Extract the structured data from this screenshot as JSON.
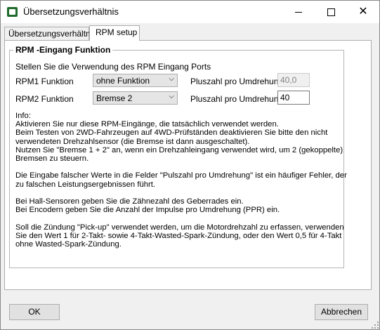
{
  "window": {
    "title": "Übersetzungsverhältnis"
  },
  "tabs": [
    {
      "label": "Übersetzungsverhältnis"
    },
    {
      "label": "RPM setup"
    }
  ],
  "group": {
    "title": "RPM -Eingang Funktion",
    "intro": "Stellen Sie die Verwendung des RPM Eingang Ports",
    "rows": [
      {
        "label": "RPM1 Funktion",
        "select": "ohne Funktion",
        "pulse_label": "Pluszahl pro Umdrehung:",
        "pulse_value": "40,0"
      },
      {
        "label": "RPM2 Funktion",
        "select": "Bremse 2",
        "pulse_label": "Pluszahl pro Umdrehung:",
        "pulse_value": "40"
      }
    ],
    "info": "Info:\nAktivieren Sie nur diese RPM-Eingänge, die tatsächlich verwendet werden.\nBeim Testen von 2WD-Fahrzeugen auf 4WD-Prüfständen deaktivieren Sie bitte den nicht\nverwendeten Drehzahlsensor (die Bremse ist dann ausgeschaltet).\nNutzen Sie \"Bremse 1 + 2\" an, wenn ein Drehzahleingang verwendet wird, um 2 (gekoppelte)\nBremsen zu steuern.\n\nDie Eingabe falscher Werte in die Felder \"Pulszahl pro Umdrehung\" ist ein häufiger Fehler, der\nzu falschen Leistungsergebnissen führt.\n\nBei Hall-Sensoren geben Sie die Zähnezahl des Geberrades ein.\nBei Encodern geben Sie die Anzahl der Impulse pro Umdrehung (PPR) ein.\n\nSoll die Zündung \"Pick-up\" verwendet werden, um die Motordrehzahl zu erfassen, verwenden\nSie den Wert 1 für 2-Takt- sowie 4-Takt-Wasted-Spark-Zündung, oder den Wert 0,5 für 4-Takt\nohne Wasted-Spark-Zündung."
  },
  "buttons": {
    "ok": "OK",
    "cancel": "Abbrechen"
  }
}
